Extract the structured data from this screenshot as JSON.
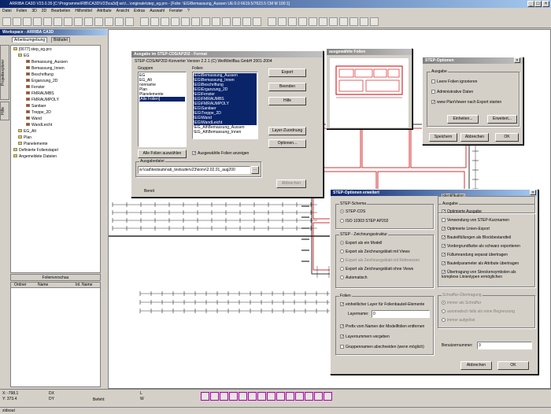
{
  "app": {
    "title": "ARRIBA CA3D V23.0.35 [C:\\Programme\\RIB\\CA3D\\V23\\ca3d] w/c\\...\\originale\\step_eg.pro - [Folie: \\EG\\Bemassung_Aussen   UE:0.0   6619.5/7623.5 CM   M 100:1]"
  },
  "menu": [
    "Datei",
    "Folien",
    "3D",
    "2D",
    "Bearbeiten",
    "Hilfsmittel",
    "Attribute",
    "Ansicht",
    "Extras",
    "Auswahl",
    "Fenster",
    "?"
  ],
  "workspace": {
    "title": "Workspace - ARRIBA CA3D",
    "tabs": [
      "Arbeitsumgebung",
      "Bildtafel"
    ],
    "side_tabs": [
      "Projektexplorer",
      "Hilfe"
    ],
    "tree": [
      "[0677] step_eg.pro",
      "EG",
      "Bemassung_Aussen",
      "Bemassung_Innen",
      "Beschriftung",
      "Erganzung_2D",
      "Fenster",
      "FMRAUMBS",
      "FMRAUMPOLY",
      "Sanitaer",
      "Treppe_2D",
      "Wand",
      "WandLeicht",
      "EG_Alt",
      "Plan",
      "Planelemente",
      "Definierte Folienstapel",
      "Angemeldete Dateien"
    ],
    "preview": "Folienvorschau",
    "columns": [
      "Ordner",
      "Name",
      "Inl. Name"
    ]
  },
  "status": {
    "x": "X: -798.1",
    "y": "Y: 373.4",
    "dx": "DX",
    "dy": "DY",
    "l": "L",
    "w": "W",
    "cmd": "Befehl:",
    "hint": "zidsout"
  },
  "export": {
    "title": "Ausgabe im STEP-CDS/AP202 - Format",
    "version": "STEP-CDS/AP202-Konverter Version 2.2.1 (C) WeilWeilBau GmbH 2001-2004",
    "groups_label": "Gruppen",
    "groups": [
      "EG",
      "EG_Alt",
      "nonname",
      "Plan",
      "Planelemente",
      "[Alle Folien]"
    ],
    "folien_label": "Folien",
    "folien": [
      "\\EG\\Bemassung_Aussen",
      "\\EG\\Bemassung_Innen",
      "\\EG\\Beschriftung",
      "\\EG\\Erganzung_2D",
      "\\EG\\Fenster",
      "\\EG\\FMRAUMBS",
      "\\EG\\FMRAUMPOLY",
      "\\EG\\Sanitaer",
      "\\EG\\Treppe_2D",
      "\\EG\\Wand",
      "\\EG\\WandLeicht",
      "\\EG_Alt\\Bemassung_Aussen",
      "\\EG_Alt\\Bemassung_Innen"
    ],
    "btn_export": "Export",
    "btn_beenden": "Beenden",
    "btn_hilfe": "Hilfe",
    "btn_layer": "Layer-Zuordnung",
    "btn_optionen": "Optionen...",
    "btn_all": "Alle Folien auswählen",
    "chk_sel": "Ausgewählte Folien anzeigen",
    "file_label": "Ausgabedatei",
    "file": "w:\\cad\\testsuite\\ab_testsuite\\v23\\konv\\2.02.01_aug200",
    "browse": "...",
    "status": "Bereit",
    "cancel": "Abbrechen"
  },
  "preview": {
    "title": "ausgewählte Folien"
  },
  "opts": {
    "title": "STEP-Optionen",
    "group": "Ausgabe",
    "c1": "Leere Folien ignorieren",
    "c2": "Administrative Daten",
    "c3": "www PlanViewer nach Export starten",
    "b_simple": "Einheiten...",
    "b_ext": "Erweitert...",
    "b_save": "Speichern",
    "b_cancel": "Abbrechen",
    "b_ok": "OK"
  },
  "ext": {
    "title": "STEP-Optionen erweitert",
    "schema_label": "STEP-Schema",
    "schema": [
      "STEP-CDS",
      "ISO 10303 STEP AP202"
    ],
    "struct_label": "STEP - Zeichnungsstruktur",
    "struct": [
      "Export als ein Modell",
      "Export als Zeichnungsblatt mit Views",
      "Export als Zeichnungsblatt mit Referenzen",
      "Export als Zeichnungsblatt ohne Views",
      "Automatisch"
    ],
    "folien_label": "Folien",
    "f1": "einheitlicher Layer für Folienbauteil-Elemente",
    "layer_label": "Layername:",
    "layer_val": "0",
    "f2": "Prefix vom Namen der Modellfolien entfernen",
    "f3": "Layernummern vergeben",
    "f4": "Gruppennamen abschneiden (wenn möglich)",
    "out_label": "Ausgabe",
    "out": [
      "Optimierte Ausgabe",
      "Verwendung von STEP-Kurznamen",
      "Optimierte Linien-Export",
      "Bauteilfüllungen als Blockbestandteil",
      "Vordergrundfarbe als schwarz exportieren",
      "Füllumrandung separat übertragen",
      "Bauteilparameter als Attribute übertragen",
      "Übertragung von Streckensymbolen als komplexe Linientypen ermöglichen"
    ],
    "sch_label": "Schraffur-Übertragung",
    "sch": [
      "immer als Schraffur",
      "automatisch falls als reine Begrenzung",
      "immer aufgelöst"
    ],
    "id_label": "Identifikation",
    "id_field": "Benutzernummer:",
    "id_val": "3",
    "b_cancel": "Abbrechen",
    "b_ok": "OK"
  }
}
